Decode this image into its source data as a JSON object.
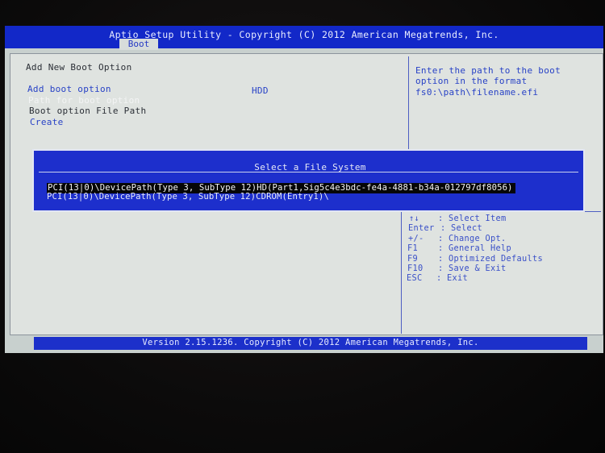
{
  "header": {
    "title": "Aptio Setup Utility - Copyright (C) 2012 American Megatrends, Inc.",
    "active_tab": "Boot"
  },
  "section": {
    "heading": "Add New Boot Option",
    "items": [
      {
        "label": "Add boot option",
        "value": "HDD"
      },
      {
        "label": "Path for boot option",
        "value": ""
      },
      {
        "label": "Boot option File Path",
        "value": ""
      },
      {
        "label": "Create",
        "value": ""
      }
    ]
  },
  "help": {
    "lines": [
      "Enter the path to the boot",
      "option in the format",
      "fs0:\\path\\filename.efi"
    ]
  },
  "dialog": {
    "title": "Select a File System",
    "options": [
      "PCI(13|0)\\DevicePath(Type 3, SubType 12)HD(Part1,Sig5c4e3bdc-fe4a-4881-b34a-012797df8056)",
      "PCI(13|0)\\DevicePath(Type 3, SubType 12)CDROM(Entry1)\\"
    ],
    "selected_index": 0
  },
  "keys": [
    {
      "key": "↑↓",
      "desc": ": Select Item"
    },
    {
      "key": "Enter",
      "desc": ": Select"
    },
    {
      "key": "+/-",
      "desc": ": Change Opt."
    },
    {
      "key": "F1",
      "desc": ": General Help"
    },
    {
      "key": "F9",
      "desc": ": Optimized Defaults"
    },
    {
      "key": "F10",
      "desc": ": Save & Exit"
    },
    {
      "key": "ESC",
      "desc": ": Exit"
    }
  ],
  "footer": {
    "text": "Version 2.15.1236. Copyright (C) 2012 American Megatrends, Inc."
  }
}
